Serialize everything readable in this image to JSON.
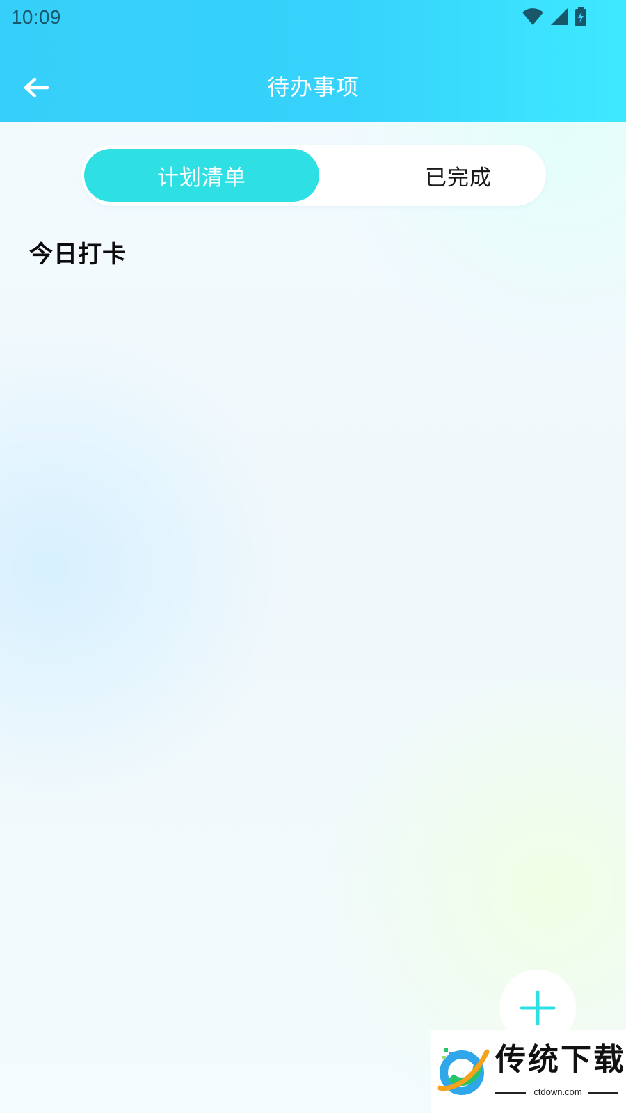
{
  "status_bar": {
    "time": "10:09",
    "icons": [
      "wifi-icon",
      "signal-icon",
      "battery-charging-icon"
    ]
  },
  "header": {
    "title": "待办事项",
    "back_icon": "arrow-left-icon"
  },
  "tabs": [
    {
      "label": "计划清单",
      "active": true
    },
    {
      "label": "已完成",
      "active": false
    }
  ],
  "section": {
    "title": "今日打卡"
  },
  "fab": {
    "icon": "plus-icon"
  },
  "watermark": {
    "name": "传统下载",
    "domain": "ctdown.com"
  },
  "colors": {
    "header": "#36cff9",
    "accent": "#2ee0e4",
    "status_text": "#18566a"
  }
}
